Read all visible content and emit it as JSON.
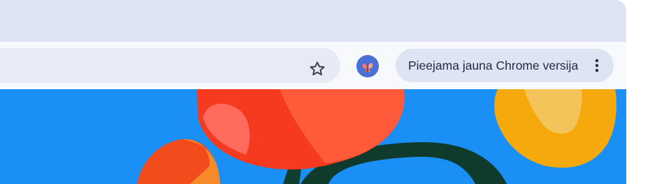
{
  "toolbar": {
    "update_button_label": "Pieejama jauna Chrome versija"
  },
  "icons": {
    "bookmark": "star-outline-icon",
    "profile": "butterfly-avatar",
    "menu": "three-dots-vertical-icon"
  },
  "colors": {
    "titlebar": "#dde3f2",
    "toolbar": "#f8f9fd",
    "omnibox": "#e8ebf5",
    "chip": "#dfe4f3",
    "chip_text": "#1f2a44",
    "avatar": "#4a6fd6",
    "wallpaper_background": "#1a8ff5"
  }
}
